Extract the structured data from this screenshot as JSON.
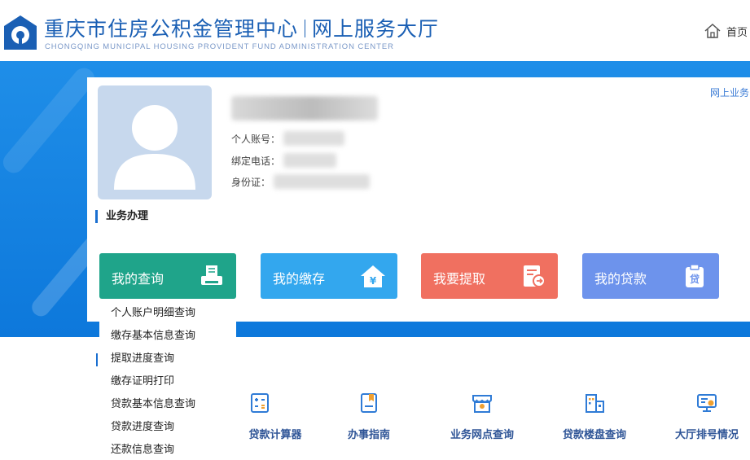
{
  "header": {
    "title_left": "重庆市住房公积金管理中心",
    "title_right": "网上服务大厅",
    "subtitle": "CHONGQING MUNICIPAL HOUSING PROVIDENT FUND ADMINISTRATION CENTER",
    "home_label": "首页"
  },
  "profile": {
    "account_label": "个人账号：",
    "phone_label": "绑定电话：",
    "id_label": "身份证：",
    "top_link": "网上业务"
  },
  "section": {
    "title": "业务办理"
  },
  "cards": [
    {
      "label": "我的查询",
      "icon": "printer-icon",
      "color": "#1fa48a"
    },
    {
      "label": "我的缴存",
      "icon": "house-yuan-icon",
      "color": "#33a7ee"
    },
    {
      "label": "我要提取",
      "icon": "withdraw-doc-icon",
      "color": "#f07060"
    },
    {
      "label": "我的贷款",
      "icon": "loan-clipboard-icon",
      "color": "#6d93ec"
    }
  ],
  "dropdown": {
    "items": [
      "个人账户明细查询",
      "缴存基本信息查询",
      "提取进度查询",
      "缴存证明打印",
      "贷款基本信息查询",
      "贷款进度查询",
      "还款信息查询"
    ]
  },
  "tools": [
    {
      "label": "贷款计算器",
      "icon": "calculator-icon"
    },
    {
      "label": "办事指南",
      "icon": "guide-book-icon"
    },
    {
      "label": "业务网点查询",
      "icon": "branch-store-icon"
    },
    {
      "label": "贷款楼盘查询",
      "icon": "building-icon"
    },
    {
      "label": "大厅排号情况",
      "icon": "queue-monitor-icon"
    }
  ],
  "colors": {
    "brand": "#1a5fb4",
    "banner": "#1f8ee8",
    "tool_text": "#2f5597"
  }
}
